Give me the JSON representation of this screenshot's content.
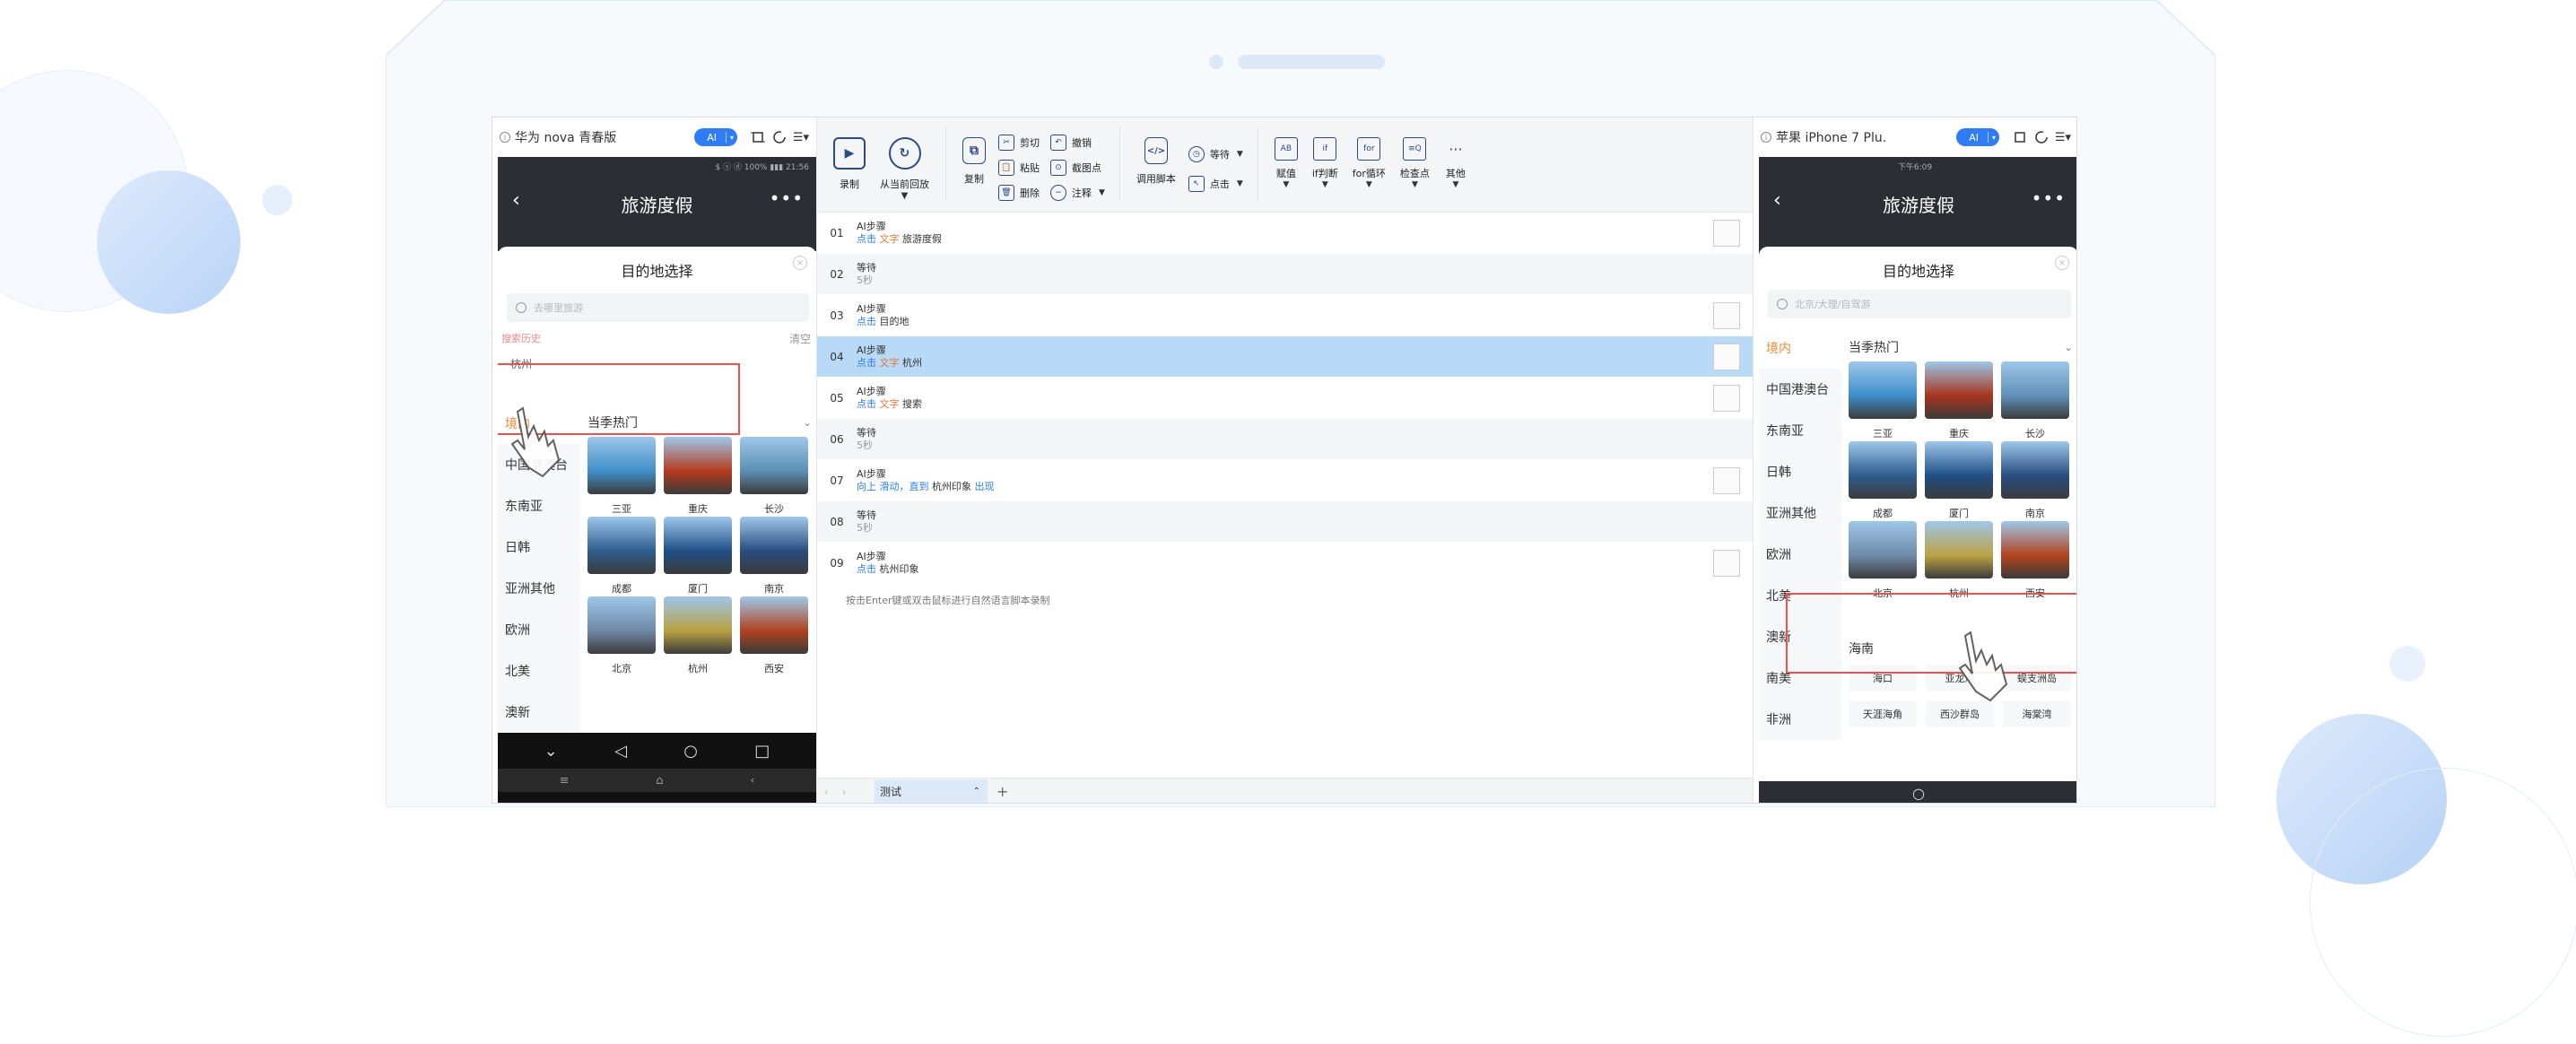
{
  "left_phone": {
    "device_name": "华为 nova 青春版",
    "ai_label": "AI",
    "status_text": "$ ⓢ ⓓ 100% ▮▮▮ 21:56",
    "page_title": "旅游度假",
    "sheet_title": "目的地选择",
    "search_placeholder": "去哪里旅游",
    "history_label": "搜索历史",
    "history_clear": "清空",
    "history_item": "杭州",
    "categories": [
      "境内",
      "中国港澳台",
      "东南亚",
      "日韩",
      "亚洲其他",
      "欧洲",
      "北美",
      "澳新"
    ],
    "hot_title": "当季热门",
    "destinations": [
      {
        "name": "三亚",
        "color": "#3f8fc9"
      },
      {
        "name": "重庆",
        "color": "#b43a1d"
      },
      {
        "name": "长沙",
        "color": "#5c8fb5"
      },
      {
        "name": "成都",
        "color": "#2d5d8f"
      },
      {
        "name": "厦门",
        "color": "#1f4f86"
      },
      {
        "name": "南京",
        "color": "#274d80"
      },
      {
        "name": "北京",
        "color": "#6f88a6"
      },
      {
        "name": "杭州",
        "color": "#b9a042"
      },
      {
        "name": "西安",
        "color": "#b0421f"
      }
    ]
  },
  "right_phone": {
    "device_name": "苹果 iPhone 7 Plu.",
    "ai_label": "AI",
    "status_text": "下午6:09",
    "page_title": "旅游度假",
    "sheet_title": "目的地选择",
    "search_placeholder": "北京/大理/自驾游",
    "categories": [
      "境内",
      "中国港澳台",
      "东南亚",
      "日韩",
      "亚洲其他",
      "欧洲",
      "北美",
      "澳新",
      "南美",
      "非洲"
    ],
    "hot_title": "当季热门",
    "destinations": [
      {
        "name": "三亚",
        "color": "#3d8ecb"
      },
      {
        "name": "重庆",
        "color": "#a8341c"
      },
      {
        "name": "长沙",
        "color": "#5f90b8"
      },
      {
        "name": "成都",
        "color": "#2c5c8e"
      },
      {
        "name": "厦门",
        "color": "#1e4e85"
      },
      {
        "name": "南京",
        "color": "#284e81"
      },
      {
        "name": "北京",
        "color": "#708aa8"
      },
      {
        "name": "杭州",
        "color": "#bba244"
      },
      {
        "name": "西安",
        "color": "#b2431f"
      }
    ],
    "section2_title": "海南",
    "section2_items": [
      "海口",
      "亚龙湾",
      "蜈支洲岛",
      "天涯海角",
      "西沙群岛",
      "海棠湾"
    ]
  },
  "toolbar": {
    "record": "录制",
    "from_current": "从当前回放",
    "copy": "复制",
    "cut": "剪切",
    "paste": "粘贴",
    "delete": "删除",
    "undo": "撤销",
    "screenshot_point": "截图点",
    "comment": "注释",
    "call_script": "调用脚本",
    "wait": "等待",
    "click": "点击",
    "assign": "赋值",
    "if_judge": "if判断",
    "for_loop": "for循环",
    "checkpoint": "检查点",
    "other": "其他"
  },
  "steps": [
    {
      "num": "01",
      "kind": "AI步骤",
      "action": "点击",
      "type": "文字",
      "target": "旅游度假",
      "snap": true
    },
    {
      "num": "02",
      "kind": "等待",
      "extra": "5秒",
      "snap": false
    },
    {
      "num": "03",
      "kind": "AI步骤",
      "action": "点击",
      "type": "",
      "target": "目的地",
      "snap": true
    },
    {
      "num": "04",
      "kind": "AI步骤",
      "action": "点击",
      "type": "文字",
      "target": "杭州",
      "snap": true
    },
    {
      "num": "05",
      "kind": "AI步骤",
      "action": "点击",
      "type": "文字",
      "target": "搜索",
      "snap": true
    },
    {
      "num": "06",
      "kind": "等待",
      "extra": "5秒",
      "snap": false
    },
    {
      "num": "07",
      "kind": "AI步骤",
      "action": "向上",
      "type": "滑动，直到",
      "target": "杭州印象",
      "tail": "出现",
      "snap": true
    },
    {
      "num": "08",
      "kind": "等待",
      "extra": "5秒",
      "snap": false
    },
    {
      "num": "09",
      "kind": "AI步骤",
      "action": "点击",
      "type": "",
      "target": "杭州印象",
      "snap": true
    }
  ],
  "hint": "按击Enter键或双击鼠标进行自然语言脚本录制",
  "tabs": {
    "current": "测试",
    "add": "+"
  },
  "colors": {
    "accent": "#2f7cf6",
    "selected_row": "#b8daf7",
    "orange": "#f08a3c",
    "red_box": "#f05050"
  }
}
